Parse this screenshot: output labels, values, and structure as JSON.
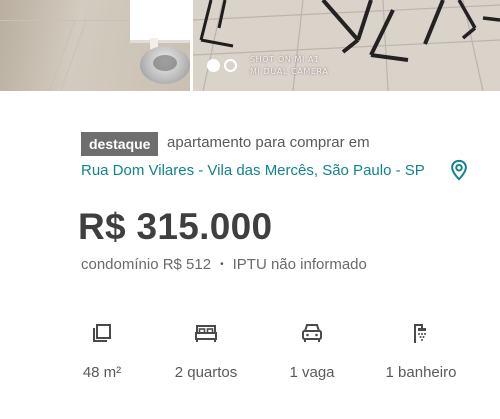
{
  "gallery": {
    "photos": [
      {
        "alt": "",
        "description": ""
      },
      {
        "alt": "",
        "description": ""
      }
    ],
    "watermark": [
      "SHOT ON MI A1",
      "MI DUAL CAMERA"
    ],
    "pager": {
      "current": 1,
      "total": 2
    }
  },
  "listing": {
    "badge": "destaque",
    "subtitle": "apartamento para comprar em",
    "address": "Rua Dom Vilares - Vila das Mercês, São Paulo - SP",
    "price": "R$ 315.000",
    "condo_fee": "condomínio R$ 512",
    "fee_separator": "•",
    "iptu": "IPTU não informado"
  },
  "features": [
    {
      "icon": "area-icon",
      "label": "48 m²"
    },
    {
      "icon": "bed-icon",
      "label": "2 quartos"
    },
    {
      "icon": "car-icon",
      "label": "1 vaga"
    },
    {
      "icon": "shower-icon",
      "label": "1 banheiro"
    }
  ],
  "colors": {
    "accent": "#11848e",
    "badge_bg": "#6e6e6e",
    "price": "#3f3f3f"
  }
}
